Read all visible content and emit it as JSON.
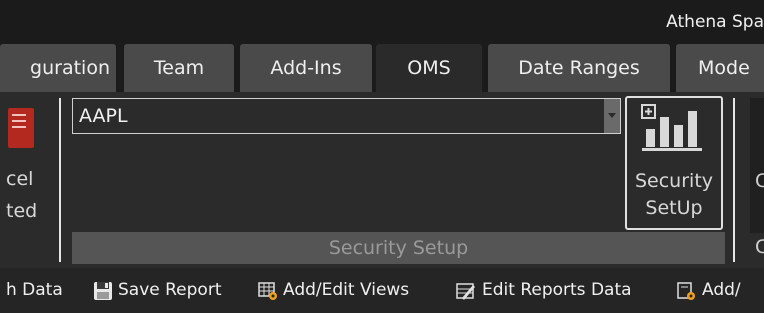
{
  "app": {
    "title": "Athena Spa"
  },
  "tabs": [
    {
      "label": "guration",
      "active": false
    },
    {
      "label": "Team",
      "active": false
    },
    {
      "label": "Add-Ins",
      "active": false
    },
    {
      "label": "OMS",
      "active": true
    },
    {
      "label": "Date Ranges",
      "active": false
    },
    {
      "label": "Mode",
      "active": false
    }
  ],
  "left_group": {
    "label_line1": "cel",
    "label_line2": "ted"
  },
  "security_combo": {
    "value": "AAPL"
  },
  "security_button": {
    "label_line1": "Security",
    "label_line2": "SetUp"
  },
  "group": {
    "label": "Security Setup"
  },
  "right_cut": {
    "letter1": "C",
    "letter2": "C"
  },
  "toolbar": {
    "items": [
      {
        "label": "h Data",
        "icon": ""
      },
      {
        "label": "Save Report",
        "icon": "floppy-disk-icon"
      },
      {
        "label": "Add/Edit Views",
        "icon": "grid-gear-icon"
      },
      {
        "label": "Edit Reports Data",
        "icon": "edit-data-icon"
      },
      {
        "label": "Add/",
        "icon": "form-gear-icon"
      }
    ]
  },
  "colors": {
    "accent": "#f0a020",
    "tab_inactive": "#4a4a4a",
    "tab_active": "#2a2a2a",
    "ribbon": "#2b2b2b"
  }
}
